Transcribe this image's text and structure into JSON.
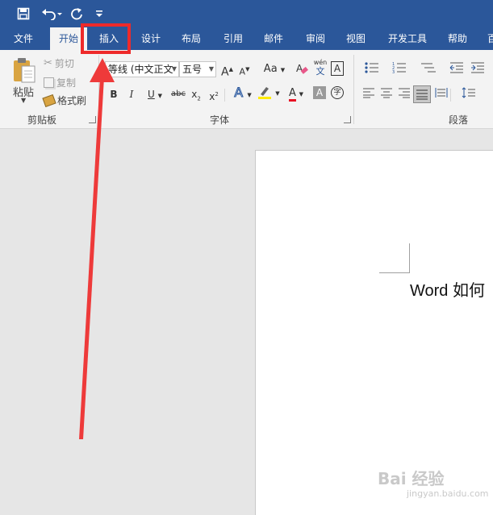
{
  "quick_access": {
    "save_icon": "save-icon",
    "undo_icon": "undo-icon",
    "redo_icon": "redo-icon",
    "customize_icon": "customize-qat-icon"
  },
  "tabs": [
    {
      "label": "文件",
      "active": false
    },
    {
      "label": "开始",
      "active": true
    },
    {
      "label": "插入",
      "active": false,
      "highlighted": true
    },
    {
      "label": "设计",
      "active": false
    },
    {
      "label": "布局",
      "active": false
    },
    {
      "label": "引用",
      "active": false
    },
    {
      "label": "邮件",
      "active": false
    },
    {
      "label": "审阅",
      "active": false
    },
    {
      "label": "视图",
      "active": false
    },
    {
      "label": "开发工具",
      "active": false
    },
    {
      "label": "帮助",
      "active": false
    },
    {
      "label": "百",
      "active": false
    }
  ],
  "clipboard": {
    "paste_label": "粘贴",
    "cut_label": "剪切",
    "copy_label": "复制",
    "format_painter_label": "格式刷",
    "group_label": "剪贴板"
  },
  "font": {
    "font_name": "等线 (中文正文",
    "font_size": "五号",
    "group_label": "字体",
    "phonetic_top": "wén",
    "phonetic_bottom": "文",
    "char_border": "A",
    "grow": "A",
    "shrink": "A",
    "change_case": "Aa",
    "bold": "B",
    "italic": "I",
    "underline": "U",
    "strikethrough": "abc",
    "subscript": "x",
    "superscript": "x",
    "sub_mark": "2",
    "sup_mark": "2",
    "text_effect": "A",
    "font_color": "A",
    "char_shading": "A",
    "enclose_char": "字"
  },
  "paragraph": {
    "group_label": "段落"
  },
  "document": {
    "text": "Word 如何"
  },
  "watermark": {
    "logo": "Bai 经验",
    "url": "jingyan.baidu.com"
  },
  "colors": {
    "ribbon_blue": "#2b579a",
    "highlight_red": "#ee2a2a",
    "font_color_bar": "#e81123",
    "highlighter_yellow": "#ffeb00"
  }
}
